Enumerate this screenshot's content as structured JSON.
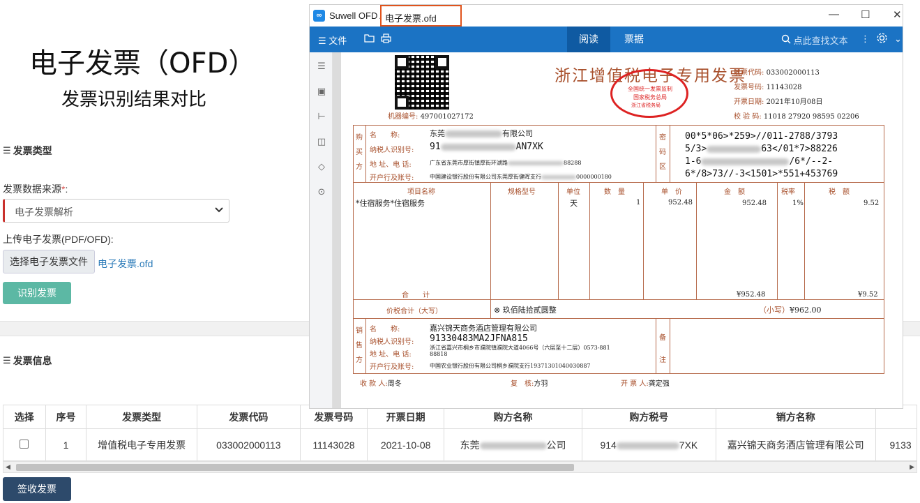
{
  "page": {
    "title": "电子发票（OFD）",
    "subtitle": "发票识别结果对比"
  },
  "form": {
    "section_type": "发票类型",
    "source_label": "发票数据来源",
    "required_mark": "*",
    "source_colon": ":",
    "source_selected": "电子发票解析",
    "upload_label": "上传电子发票(PDF/OFD):",
    "file_button": "选择电子发票文件",
    "file_name": "电子发票.ofd",
    "recognize_button": "识别发票"
  },
  "info": {
    "section_title": "发票信息",
    "columns": [
      "选择",
      "序号",
      "发票类型",
      "发票代码",
      "发票号码",
      "开票日期",
      "购方名称",
      "购方税号",
      "销方名称"
    ],
    "rows": [
      {
        "index": "1",
        "type": "增值税电子专用发票",
        "code": "033002000113",
        "number": "11143028",
        "date": "2021-10-08",
        "buyer_prefix": "东莞",
        "buyer_suffix": "公司",
        "taxid_prefix": "914",
        "taxid_suffix": "7XK",
        "seller": "嘉兴锦天商务酒店管理有限公司",
        "seller_taxid_partial": "9133"
      }
    ],
    "sign_button": "签收发票"
  },
  "viewer": {
    "app_title": "Suwell OFD App - ",
    "app_title_partial": "Suwell OFD Ap",
    "doc_title": "电子发票.ofd",
    "menu_label": "文件",
    "tab_read": "阅读",
    "tab_ticket": "票据",
    "search_placeholder": "点此查找文本",
    "icons": [
      "file-icon",
      "folder-icon",
      "print-icon",
      "search-icon",
      "more-icon",
      "settings-icon"
    ]
  },
  "invoice": {
    "title": "浙江增值税电子专用发票",
    "seal_top": "全国统一发票监制",
    "seal_mid": "国家税务总局",
    "seal_bottom": "浙江省税务局",
    "code_label": "发票代码:",
    "code_value": "033002000113",
    "number_label": "发票号码:",
    "number_value": "11143028",
    "date_label": "开票日期:",
    "date_value": "2021年10月08日",
    "check_label": "校 验 码:",
    "check_value": "11018 27920 98595 02206",
    "machine_label": "机器编号:",
    "machine_value": "497001027172",
    "buyer_side": [
      "购",
      "买",
      "方"
    ],
    "buyer_name_label": "名　　称:",
    "buyer_name_prefix": "东莞",
    "buyer_name_suffix": "有限公司",
    "buyer_taxid_label": "纳税人识别号:",
    "buyer_taxid_prefix": "91",
    "buyer_taxid_suffix": "AN7XK",
    "buyer_addr_label": "地 址、电 话:",
    "buyer_addr": "广东省东莞市厚街镇厚街环湖路",
    "buyer_addr_tail": "88288",
    "buyer_bank_label": "开户行及账号:",
    "buyer_bank": "中国建设银行股份有限公司东莞厚街健晖支行",
    "buyer_bank_tail": "0000000180",
    "pwd_side": [
      "密",
      "码",
      "区"
    ],
    "pwd_lines": [
      "00*5*06>*259>//011-2788/3793",
      "5/3>",
      "63</01*7>88226",
      "1-6",
      "/6*/--2-",
      "6*/8>73//-3<1501>*551+453769"
    ],
    "item_headers": [
      "项目名称",
      "规格型号",
      "单位",
      "数　量",
      "单　价",
      "金　额",
      "税率",
      "税　额"
    ],
    "item": {
      "name": "*住宿服务*住宿服务",
      "unit": "天",
      "qty": "1",
      "price": "952.48",
      "amount": "952.48",
      "rate": "1%",
      "tax": "9.52"
    },
    "total_label": "合　　计",
    "total_amount": "¥952.48",
    "total_tax": "¥9.52",
    "price_tax_label": "价税合计（大写）",
    "price_tax_upper": "玖佰陆拾贰圆整",
    "price_tax_lower_label": "（小写）",
    "price_tax_lower": "¥962.00",
    "seller_side": [
      "销",
      "售",
      "方"
    ],
    "seller_name_label": "名　　称:",
    "seller_name": "嘉兴锦天商务酒店管理有限公司",
    "seller_taxid_label": "纳税人识别号:",
    "seller_taxid": "91330483MA2JFNA815",
    "seller_addr_label": "地 址、电 话:",
    "seller_addr_1": "浙江省嘉兴市桐乡市濮院镇濮院大道4066号（六层至十二层）0573-881",
    "seller_addr_2": "88818",
    "seller_bank_label": "开户行及账号:",
    "seller_bank": "中国农业银行股份有限公司桐乡濮院支行19371301040030887",
    "remark_side": [
      "备",
      "注"
    ],
    "payee_label": "收 款 人:",
    "payee": "周冬",
    "reviewer_label": "复　核:",
    "reviewer": "方羽",
    "issuer_label": "开 票 人:",
    "issuer": "龚定强"
  },
  "colors": {
    "toolbar": "#1b73c4",
    "active_tab": "#0f5aa2",
    "recognize_btn": "#5cb8a4",
    "sign_btn": "#2d4a6b",
    "invoice_line": "#b66a4b",
    "seal": "#dd2222",
    "highlight_box": "#e0531c"
  }
}
